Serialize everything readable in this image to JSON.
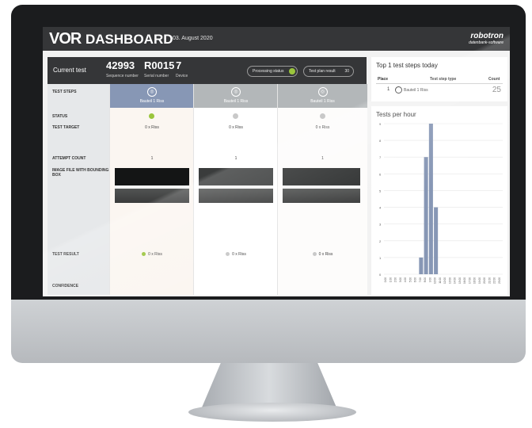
{
  "header": {
    "logo": "VOR",
    "title": "DASHBOARD",
    "date": "03. August 2020",
    "brand": "robotron",
    "brand_sub": "datenbank-software"
  },
  "current_test": {
    "title": "Current test",
    "sequence_number": "42993",
    "sequence_label": "Sequence number",
    "serial_number": "R0015",
    "serial_label": "Serial number",
    "device": "7",
    "device_label": "Device",
    "processing_status": "Processing status",
    "test_plan_result": "Test plan result",
    "test_plan_count": "30"
  },
  "row_labels": {
    "test_steps": "TEST STEPS",
    "status": "STATUS",
    "test_target": "TEST TARGET",
    "attempt_count": "ATTEMPT COUNT",
    "image_file": "IMAGE FILE WITH BOUNDING BOX",
    "test_result": "TEST RESULT",
    "confidence": "CONFIDENCE"
  },
  "steps": [
    {
      "name": "Bauteil 1 Riss",
      "target": "0 x Riss",
      "attempts": "1",
      "result": "0 x Riss",
      "status_color": "#9ac53c",
      "result_color": "#9ac53c",
      "header_color": "#8797b5"
    },
    {
      "name": "Bauteil 1 Riss",
      "target": "0 x Riss",
      "attempts": "1",
      "result": "0 x Riss",
      "status_color": "#c9c9c9",
      "result_color": "#c9c9c9",
      "header_color": "#b3b7b9"
    },
    {
      "name": "Bauteil 1 Riss",
      "target": "0 x Riss",
      "attempts": "1",
      "result": "0 x Riss",
      "status_color": "#c9c9c9",
      "result_color": "#c9c9c9",
      "header_color": "#b3b7b9"
    }
  ],
  "top_steps": {
    "title": "Top 1 test steps today",
    "col_place": "Place",
    "col_type": "Test step type",
    "col_count": "Count",
    "row": {
      "place": "1",
      "type": "Bauteil 1 Riss",
      "count": "25"
    }
  },
  "tests_per_hour": {
    "title": "Tests per hour"
  },
  "chart_data": {
    "type": "bar",
    "title": "Tests per hour",
    "categories": [
      "0:00",
      "1:00",
      "2:00",
      "3:00",
      "4:00",
      "5:00",
      "6:00",
      "7:00",
      "8:00",
      "9:00",
      "10:00",
      "11:00",
      "12:00",
      "13:00",
      "14:00",
      "15:00",
      "16:00",
      "17:00",
      "18:00",
      "19:00",
      "20:00",
      "21:00",
      "22:00",
      "23:00"
    ],
    "values": [
      0,
      0,
      0,
      0,
      0,
      0,
      0,
      1,
      7,
      9,
      4,
      0,
      0,
      0,
      0,
      0,
      0,
      0,
      0,
      0,
      0,
      0,
      0,
      0
    ],
    "ylim": [
      0,
      9
    ],
    "yticks": [
      0,
      1,
      2,
      3,
      4,
      5,
      6,
      7,
      8,
      9
    ],
    "bar_color": "#8797b5",
    "grid": true
  }
}
